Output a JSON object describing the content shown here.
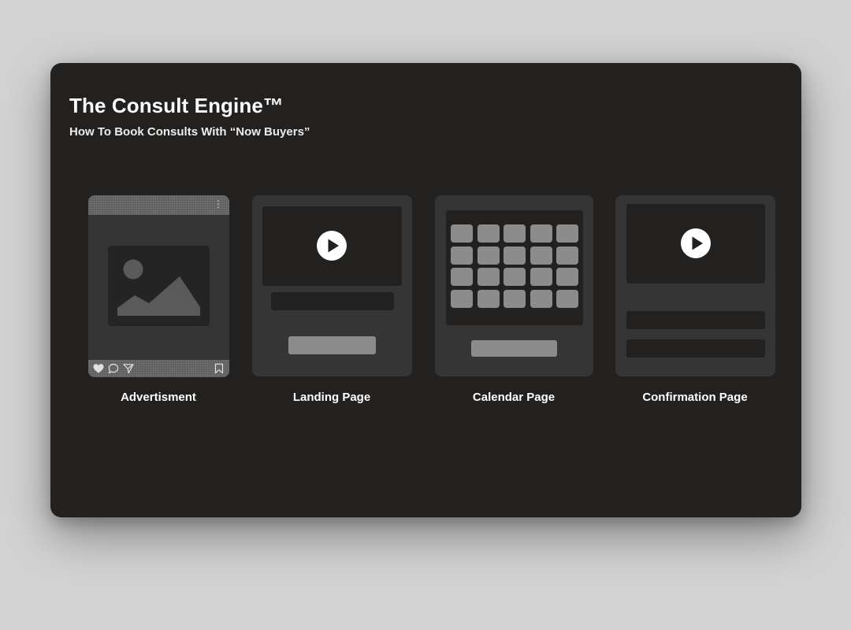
{
  "header": {
    "title": "The Consult Engine™",
    "subtitle": "How To Book Consults With “Now Buyers”"
  },
  "steps": [
    {
      "label": "Advertisment",
      "icon": "social-post-icon"
    },
    {
      "label": "Landing Page",
      "icon": "landing-page-icon"
    },
    {
      "label": "Calendar Page",
      "icon": "calendar-page-icon"
    },
    {
      "label": "Confirmation Page",
      "icon": "confirmation-page-icon"
    }
  ],
  "advert_post": {
    "menu_glyph": "⋮",
    "actions": [
      "heart-icon",
      "comment-icon",
      "share-icon",
      "bookmark-icon"
    ]
  },
  "calendar": {
    "rows": 4,
    "columns": 5
  },
  "colors": {
    "page_background": "#d3d3d3",
    "card_background": "#22211f",
    "tile_background": "#353535",
    "placeholder_dark": "#222120",
    "placeholder_light": "#8c8c8c",
    "text": "#ffffff"
  }
}
